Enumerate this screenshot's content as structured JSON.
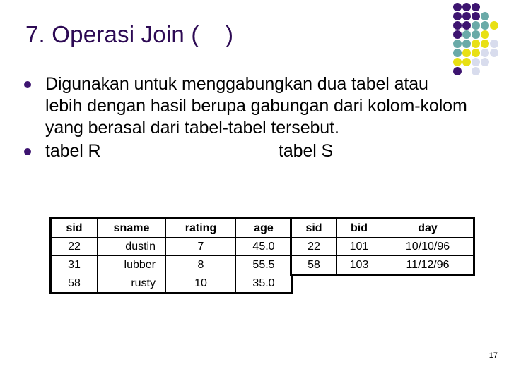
{
  "slide": {
    "title": "7. Operasi Join (    )",
    "page_number": "17",
    "background_color": "#ffffff",
    "accent_color": "#2d0a54"
  },
  "bullets": [
    {
      "marker": "bullet-dot",
      "text": "Digunakan untuk menggabungkan dua tabel atau lebih dengan hasil berupa gabungan dari kolom-kolom yang berasal dari tabel-tabel tersebut."
    },
    {
      "marker": "bullet-dot",
      "label_left": "tabel R",
      "label_right": "tabel S"
    }
  ],
  "tables": {
    "R": {
      "caption": "tabel R",
      "columns": [
        "sid",
        "sname",
        "rating",
        "age"
      ],
      "rows": [
        [
          "22",
          "dustin",
          "7",
          "45.0"
        ],
        [
          "31",
          "lubber",
          "8",
          "55.5"
        ],
        [
          "58",
          "rusty",
          "10",
          "35.0"
        ]
      ]
    },
    "S": {
      "caption": "tabel S",
      "columns": [
        "sid",
        "bid",
        "day"
      ],
      "rows": [
        [
          "22",
          "101",
          "10/10/96"
        ],
        [
          "58",
          "103",
          "11/12/96"
        ]
      ]
    }
  },
  "decoration": {
    "name": "dot-grid",
    "colors": {
      "dark_purple": "#3d1470",
      "teal": "#6aaaa8",
      "yellow": "#e8e014",
      "lavender": "#d8dced"
    },
    "dots": [
      {
        "r": 0,
        "c": 0,
        "color": "#3d1470"
      },
      {
        "r": 0,
        "c": 1,
        "color": "#3d1470"
      },
      {
        "r": 0,
        "c": 2,
        "color": "#3d1470"
      },
      {
        "r": 1,
        "c": 0,
        "color": "#3d1470"
      },
      {
        "r": 1,
        "c": 1,
        "color": "#3d1470"
      },
      {
        "r": 1,
        "c": 2,
        "color": "#3d1470"
      },
      {
        "r": 1,
        "c": 3,
        "color": "#6aaaa8"
      },
      {
        "r": 2,
        "c": 0,
        "color": "#3d1470"
      },
      {
        "r": 2,
        "c": 1,
        "color": "#3d1470"
      },
      {
        "r": 2,
        "c": 2,
        "color": "#6aaaa8"
      },
      {
        "r": 2,
        "c": 3,
        "color": "#6aaaa8"
      },
      {
        "r": 2,
        "c": 4,
        "color": "#e8e014"
      },
      {
        "r": 3,
        "c": 0,
        "color": "#3d1470"
      },
      {
        "r": 3,
        "c": 1,
        "color": "#6aaaa8"
      },
      {
        "r": 3,
        "c": 2,
        "color": "#6aaaa8"
      },
      {
        "r": 3,
        "c": 3,
        "color": "#e8e014"
      },
      {
        "r": 4,
        "c": 0,
        "color": "#6aaaa8"
      },
      {
        "r": 4,
        "c": 1,
        "color": "#6aaaa8"
      },
      {
        "r": 4,
        "c": 2,
        "color": "#e8e014"
      },
      {
        "r": 4,
        "c": 3,
        "color": "#e8e014"
      },
      {
        "r": 4,
        "c": 4,
        "color": "#d8dced"
      },
      {
        "r": 5,
        "c": 0,
        "color": "#6aaaa8"
      },
      {
        "r": 5,
        "c": 1,
        "color": "#e8e014"
      },
      {
        "r": 5,
        "c": 2,
        "color": "#e8e014"
      },
      {
        "r": 5,
        "c": 3,
        "color": "#d8dced"
      },
      {
        "r": 5,
        "c": 4,
        "color": "#d8dced"
      },
      {
        "r": 6,
        "c": 0,
        "color": "#e8e014"
      },
      {
        "r": 6,
        "c": 1,
        "color": "#e8e014"
      },
      {
        "r": 6,
        "c": 2,
        "color": "#d8dced"
      },
      {
        "r": 6,
        "c": 3,
        "color": "#d8dced"
      },
      {
        "r": 7,
        "c": 0,
        "color": "#3d1470"
      },
      {
        "r": 7,
        "c": 2,
        "color": "#d8dced"
      }
    ]
  }
}
